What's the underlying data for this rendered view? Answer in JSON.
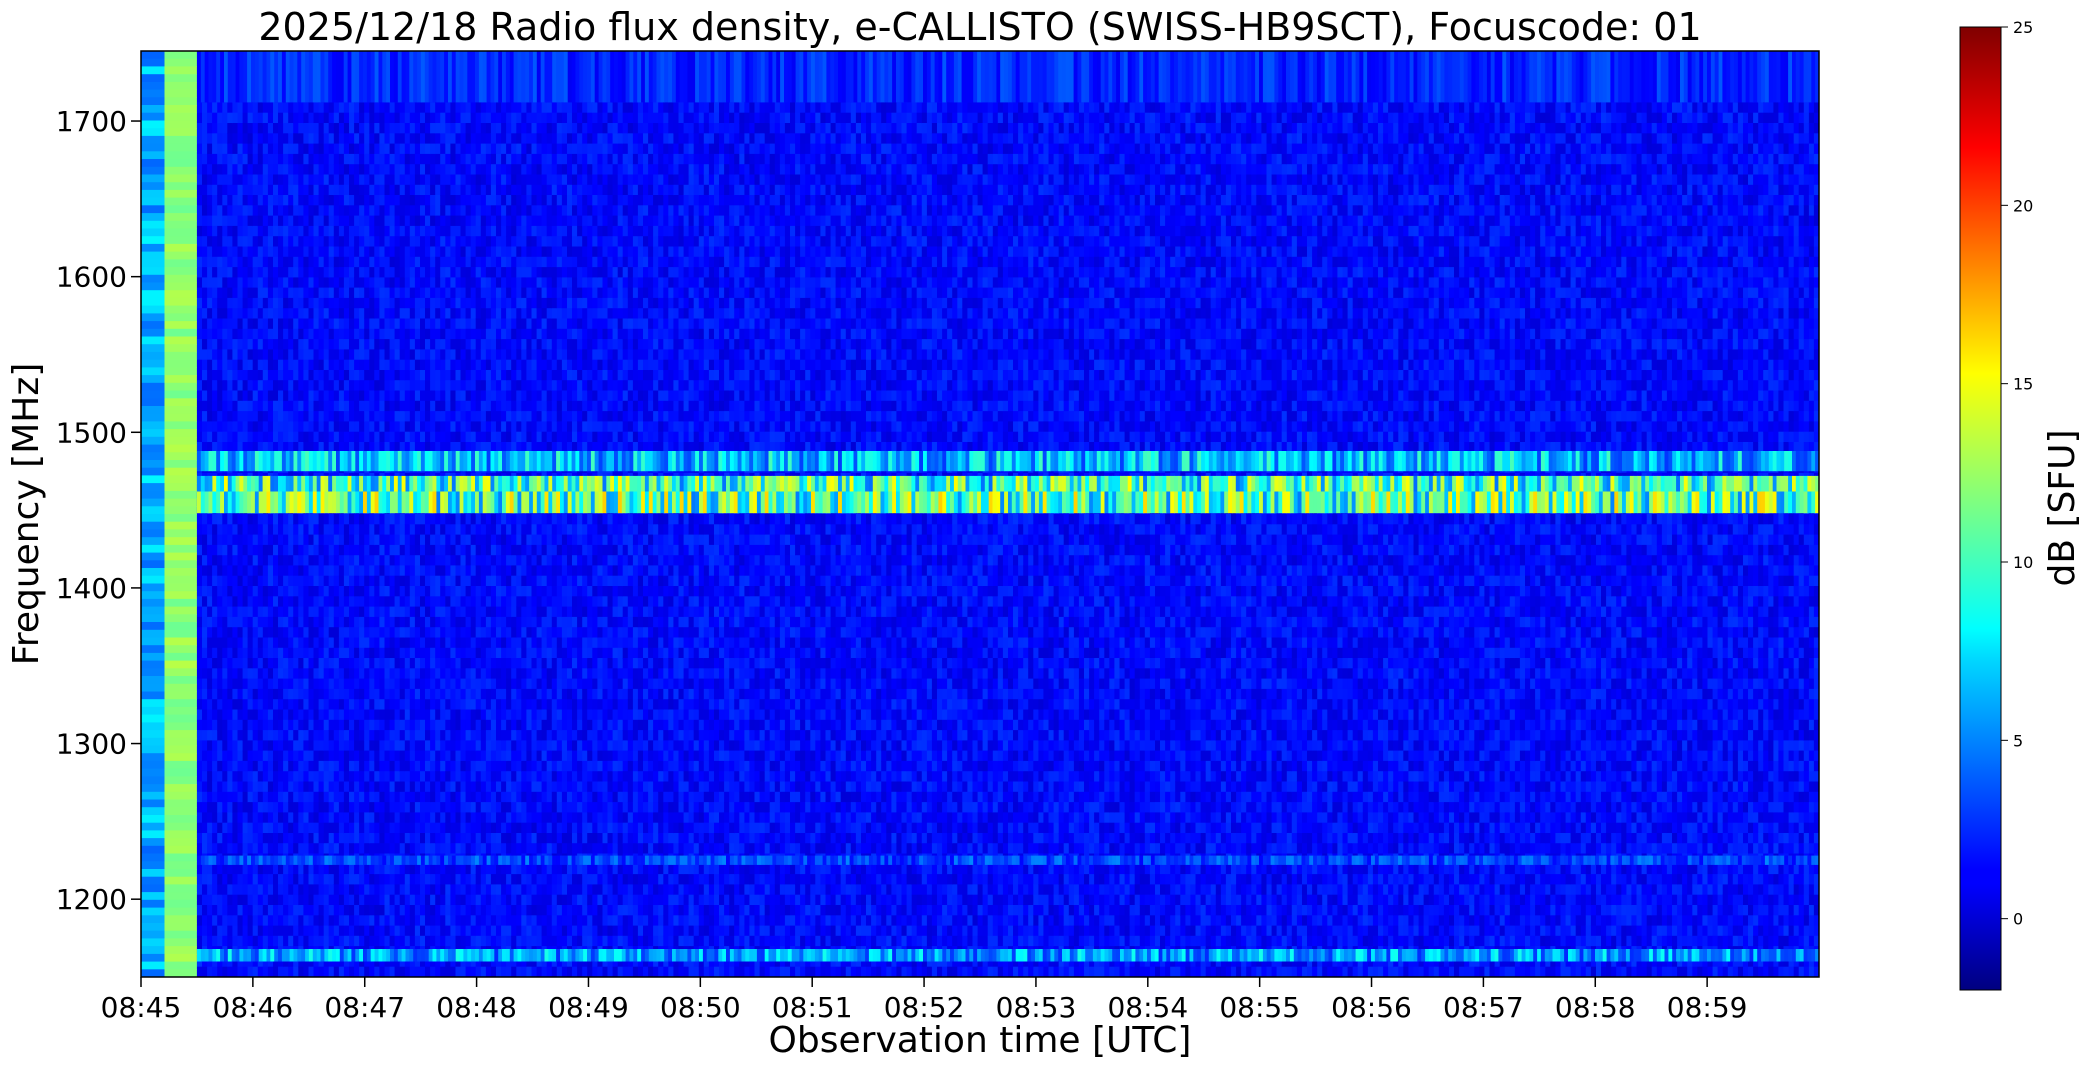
{
  "chart_data": {
    "type": "heatmap",
    "title": "2025/12/18  Radio flux density, e-CALLISTO (SWISS-HB9SCT), Focuscode: 01",
    "xlabel": "Observation time [UTC]",
    "ylabel": "Frequency [MHz]",
    "x_ticks": [
      "08:45",
      "08:46",
      "08:47",
      "08:48",
      "08:49",
      "08:50",
      "08:51",
      "08:52",
      "08:53",
      "08:54",
      "08:55",
      "08:56",
      "08:57",
      "08:58",
      "08:59"
    ],
    "xlim": [
      "08:45:00",
      "08:60:00"
    ],
    "y_ticks": [
      1200,
      1300,
      1400,
      1500,
      1600,
      1700
    ],
    "ylim": [
      1150,
      1745
    ],
    "colorbar": {
      "label": "dB [SFU]",
      "ticks": [
        0,
        5,
        10,
        15,
        20,
        25
      ],
      "range": [
        -2,
        25
      ],
      "colormap": "jet"
    },
    "calibration_interval": {
      "start": "08:45:00",
      "end": "08:45:30",
      "level_db": 12
    },
    "background_level_db": 1.5,
    "bands": [
      {
        "freq_range": [
          1160,
          1168
        ],
        "level_db": 7,
        "description": "narrow band"
      },
      {
        "freq_range": [
          1222,
          1228
        ],
        "level_db": 4,
        "description": "weak line"
      },
      {
        "freq_range": [
          1448,
          1462
        ],
        "level_db": 13,
        "description": "intense"
      },
      {
        "freq_range": [
          1462,
          1472
        ],
        "level_db": 12,
        "description": "strong"
      },
      {
        "freq_range": [
          1475,
          1488
        ],
        "level_db": 8,
        "description": "moderate"
      },
      {
        "freq_range": [
          1712,
          1745
        ],
        "level_db": 3,
        "description": "weak"
      }
    ],
    "grid": false
  },
  "colors": {
    "background": "#ffffff",
    "axes": "#000000"
  }
}
